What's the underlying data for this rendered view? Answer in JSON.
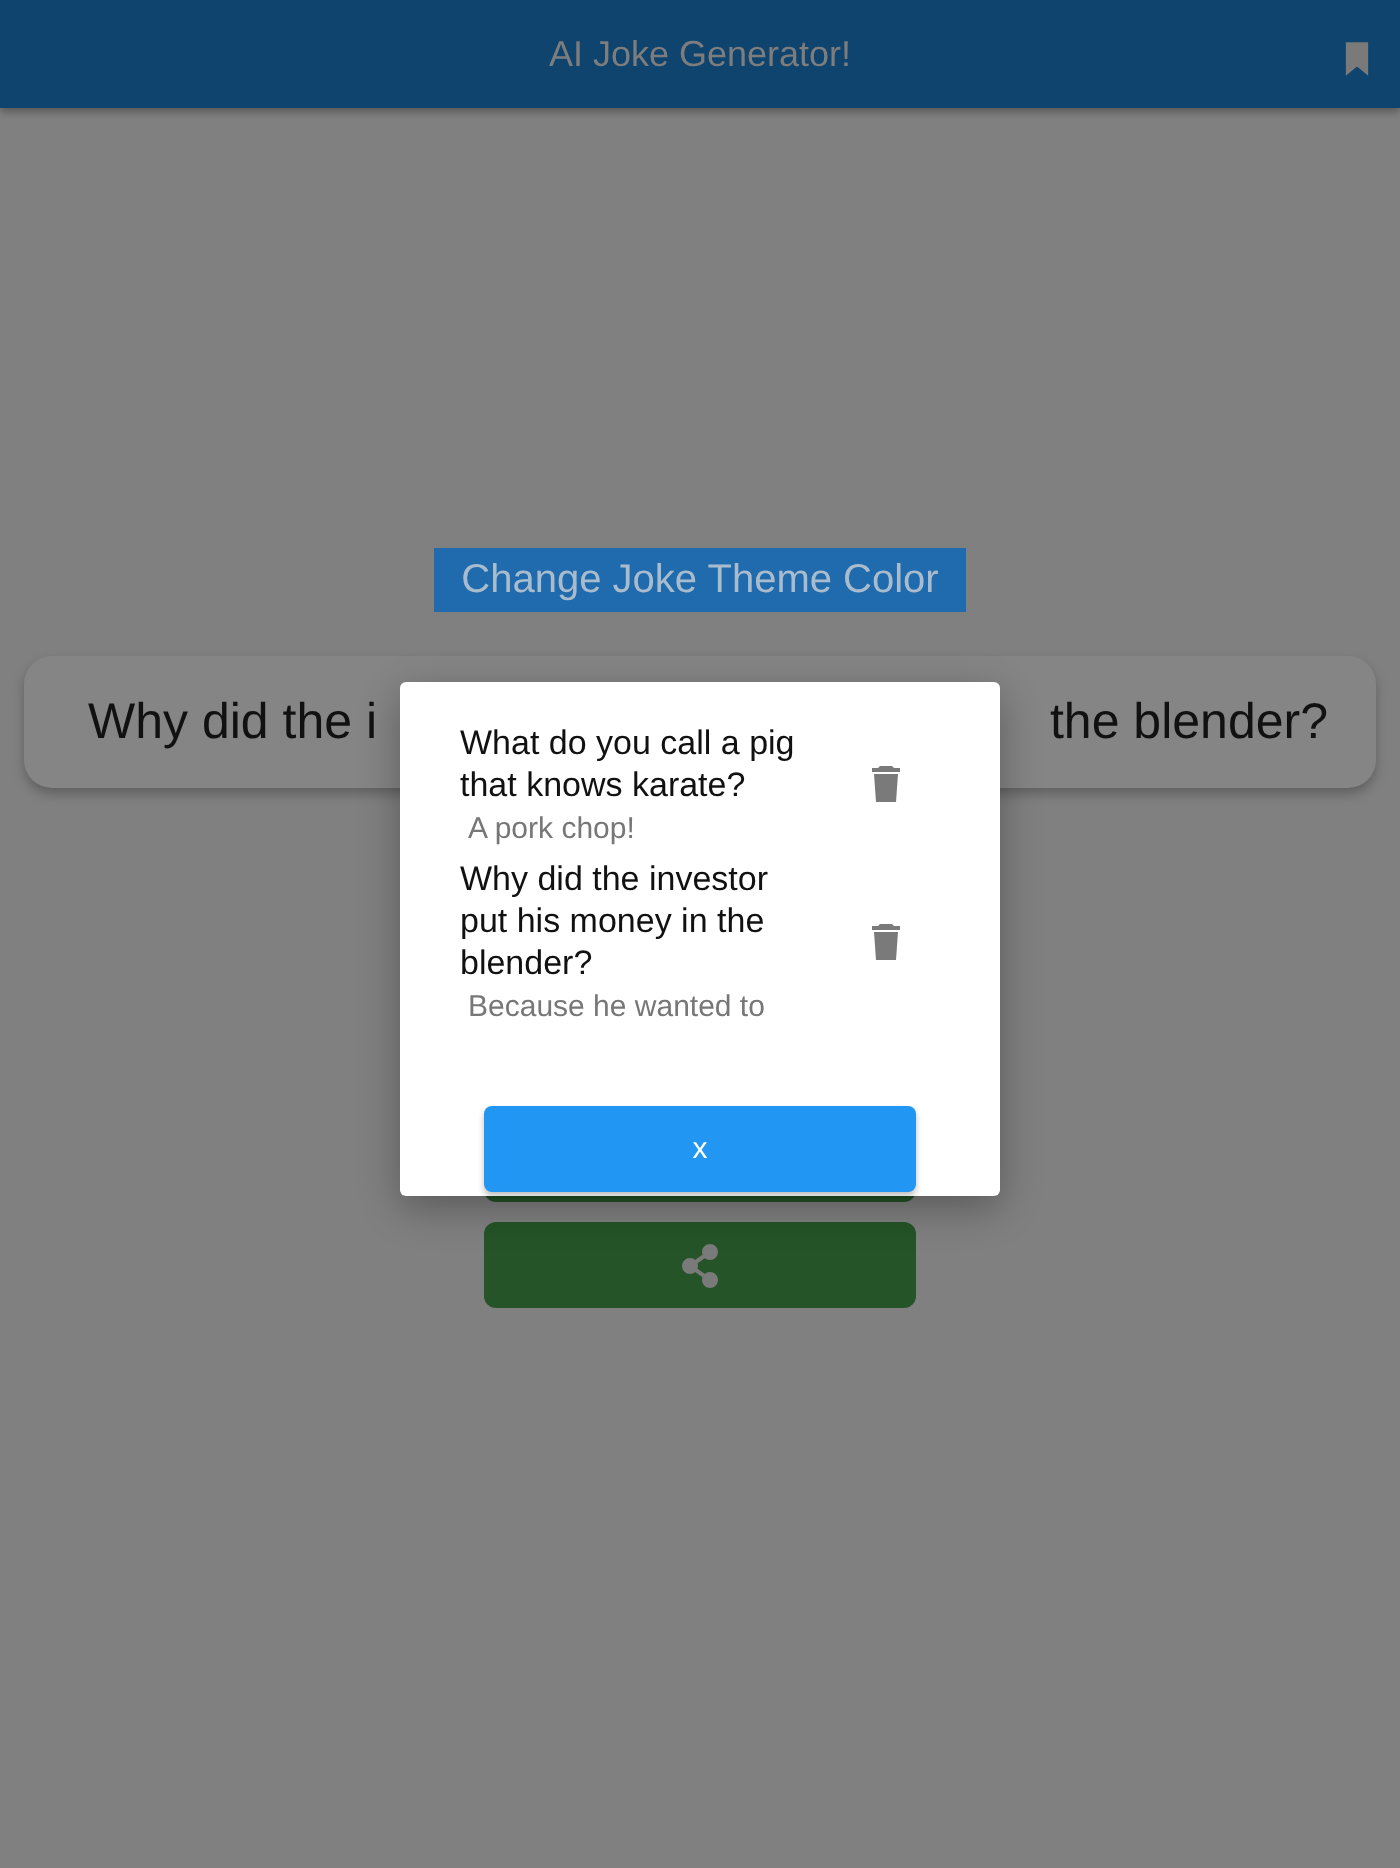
{
  "app_bar": {
    "title": "AI Joke Generator!"
  },
  "theme_button": {
    "label": "Change Joke Theme Color"
  },
  "joke_card": {
    "text_left": "Why did the i",
    "text_right": "the blender?"
  },
  "action_buttons": [
    {
      "kind": "hidden"
    },
    {
      "kind": "share"
    }
  ],
  "dialog": {
    "items": [
      {
        "question": "What do you call a pig that knows karate?",
        "answer": "A pork chop!"
      },
      {
        "question": "Why did the investor put his money in the blender?",
        "answer": "Because he wanted to"
      }
    ],
    "close_button": {
      "label": "x"
    }
  }
}
